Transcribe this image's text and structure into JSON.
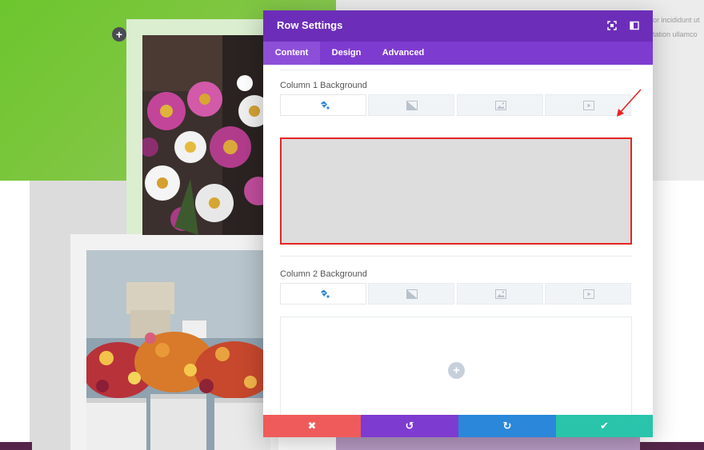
{
  "background": {
    "snippet_lines": [
      "or incididunt ut",
      "tation ullamco"
    ],
    "add_row_glyph": "+"
  },
  "modal": {
    "title": "Row Settings",
    "header_icons": [
      "fullscreen-icon",
      "sidebar-toggle-icon"
    ],
    "tabs": [
      {
        "label": "Content",
        "active": true
      },
      {
        "label": "Design",
        "active": false
      },
      {
        "label": "Advanced",
        "active": false
      }
    ],
    "column1": {
      "label": "Column 1 Background",
      "bg_type_tabs": [
        "color-fill-icon",
        "gradient-icon",
        "image-icon",
        "video-icon"
      ],
      "active_tab": 0
    },
    "column2": {
      "label": "Column 2 Background",
      "bg_type_tabs": [
        "color-fill-icon",
        "gradient-icon",
        "image-icon",
        "video-icon"
      ],
      "active_tab": 0,
      "add_glyph": "+"
    },
    "footer": {
      "buttons": [
        {
          "name": "discard-button",
          "glyph": "✖",
          "color": "#ef5b5b"
        },
        {
          "name": "undo-button",
          "glyph": "↺",
          "color": "#7e3bd0"
        },
        {
          "name": "redo-button",
          "glyph": "↻",
          "color": "#2b87da"
        },
        {
          "name": "save-button",
          "glyph": "✔",
          "color": "#29c4a9"
        }
      ]
    }
  },
  "colors": {
    "header_purple": "#6c2eb9",
    "tabs_purple": "#7e3bd0",
    "highlight_red": "#e52424",
    "background_green": "#7ec63f"
  }
}
